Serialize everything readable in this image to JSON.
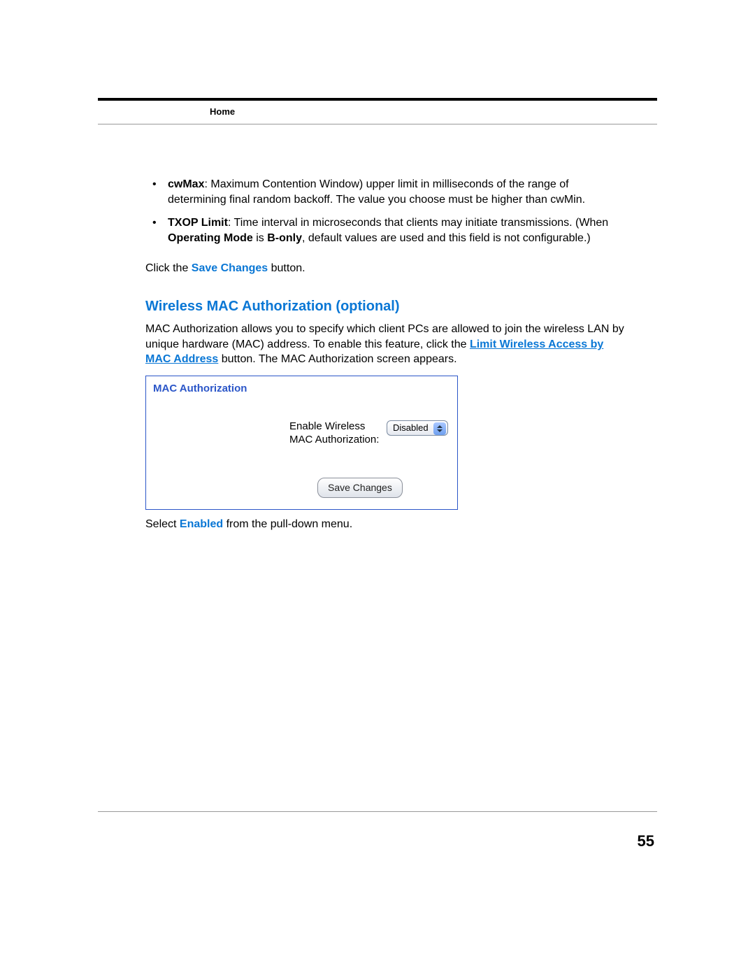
{
  "header": {
    "breadcrumb": "Home"
  },
  "bullets": [
    {
      "term": "cwMax",
      "rest": ": Maximum Contention Window) upper limit in milliseconds of the range of determining final random backoff. The value you choose must be higher than cwMin."
    },
    {
      "term": "TXOP Limit",
      "rest": ": Time interval in microseconds that clients may initiate transmissions. (When ",
      "bold2": "Operating Mode",
      "mid": " is ",
      "bold3": "B-only",
      "tail": ", default values are used and this field is not configurable.)"
    }
  ],
  "click_the": "Click the ",
  "save_changes_link": "Save Changes",
  "button_suffix": " button.",
  "section_heading": "Wireless MAC Authorization (optional)",
  "mac_para_a": "MAC Authorization allows you to specify which client PCs are allowed to join the wireless LAN by unique hardware (MAC) address. To enable this feature, click the ",
  "limit_link": "Limit Wireless Access by MAC Address",
  "mac_para_b": " button. The MAC Authorization screen appears.",
  "screenshot": {
    "title": "MAC Authorization",
    "label_line1": "Enable Wireless",
    "label_line2": "MAC Authorization:",
    "dropdown_value": "Disabled",
    "button_label": "Save Changes"
  },
  "select_a": "Select ",
  "enabled_link": "Enabled",
  "select_b": " from the pull-down menu.",
  "page_number": "55"
}
